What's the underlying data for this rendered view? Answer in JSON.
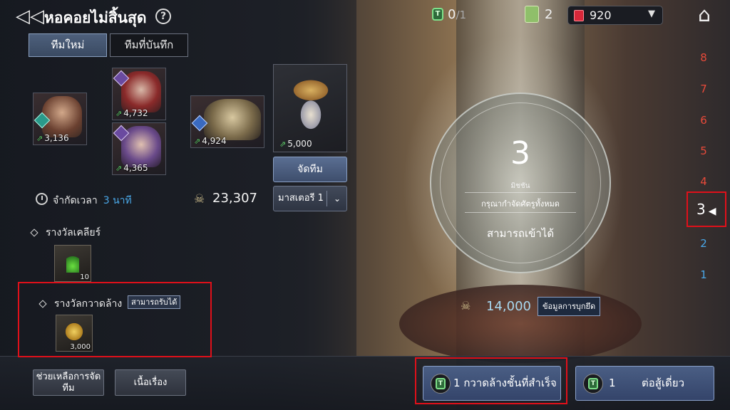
{
  "header": {
    "back_glyph": "◁◁",
    "title": "หอคอยไม่สิ้นสุด",
    "help_glyph": "?",
    "ticket_glyph": "T",
    "ticket_current": "0",
    "ticket_max": "/1",
    "scroll_count": "2",
    "gem_count": "920",
    "dropdown_glyph": "▼",
    "home_glyph": "⌂"
  },
  "tabs": [
    {
      "label": "ทีมใหม่",
      "active": true
    },
    {
      "label": "ทีมที่บันทึก",
      "active": false
    }
  ],
  "heroes": [
    {
      "power": "3,136",
      "class_icon": "healer-class-icon"
    },
    {
      "power": "4,732",
      "class_icon": "mage-class-icon"
    },
    {
      "power": "4,365",
      "class_icon": "mage-class-icon"
    },
    {
      "power": "4,924",
      "class_icon": "tank-class-icon"
    }
  ],
  "pet": {
    "power": "5,000"
  },
  "power_glyph": "⇗",
  "team_button": "จัดทีม",
  "mastery": {
    "selected": "มาสเตอรี 1",
    "chevron": "⌄"
  },
  "timer": {
    "label": "จำกัดเวลา",
    "value": "3 นาที"
  },
  "total_power": "23,307",
  "total_power_glyph": "☠",
  "clear_reward": {
    "title": "รางวัลเคลียร์",
    "quantity": "10"
  },
  "sweep_reward": {
    "title": "รางวัลกวาดล้าง",
    "badge": "สามารถรับได้",
    "quantity": "3,000"
  },
  "stage": {
    "number": "3",
    "mission_label": "มิชชัน",
    "mission_desc": "กรุณากำจัดศัตรูทั้งหมด",
    "status": "สามารถเข้าได้",
    "recommended_power": "14,000",
    "enemy_info_button": "ข้อมูลการบุกยึด"
  },
  "floors": {
    "locked": [
      "8",
      "7",
      "6",
      "5"
    ],
    "next": "4",
    "current": "3",
    "current_marker": "◀",
    "cleared": [
      "2",
      "1"
    ]
  },
  "bottom": {
    "assist_button": "ช่วยเหลือการจัดทีม",
    "story_button": "เนื้อเรื่อง",
    "sweep_button": {
      "count": "1",
      "label": "กวาดล้างชั้นที่สำเร็จ"
    },
    "solo_button": {
      "count": "1",
      "label": "ต่อสู้เดี่ยว"
    }
  },
  "colors": {
    "accent_blue": "#4aa8e8",
    "locked_red": "#e84a3a",
    "highlight_red": "#e0101a",
    "power_green": "#5fd06a"
  }
}
